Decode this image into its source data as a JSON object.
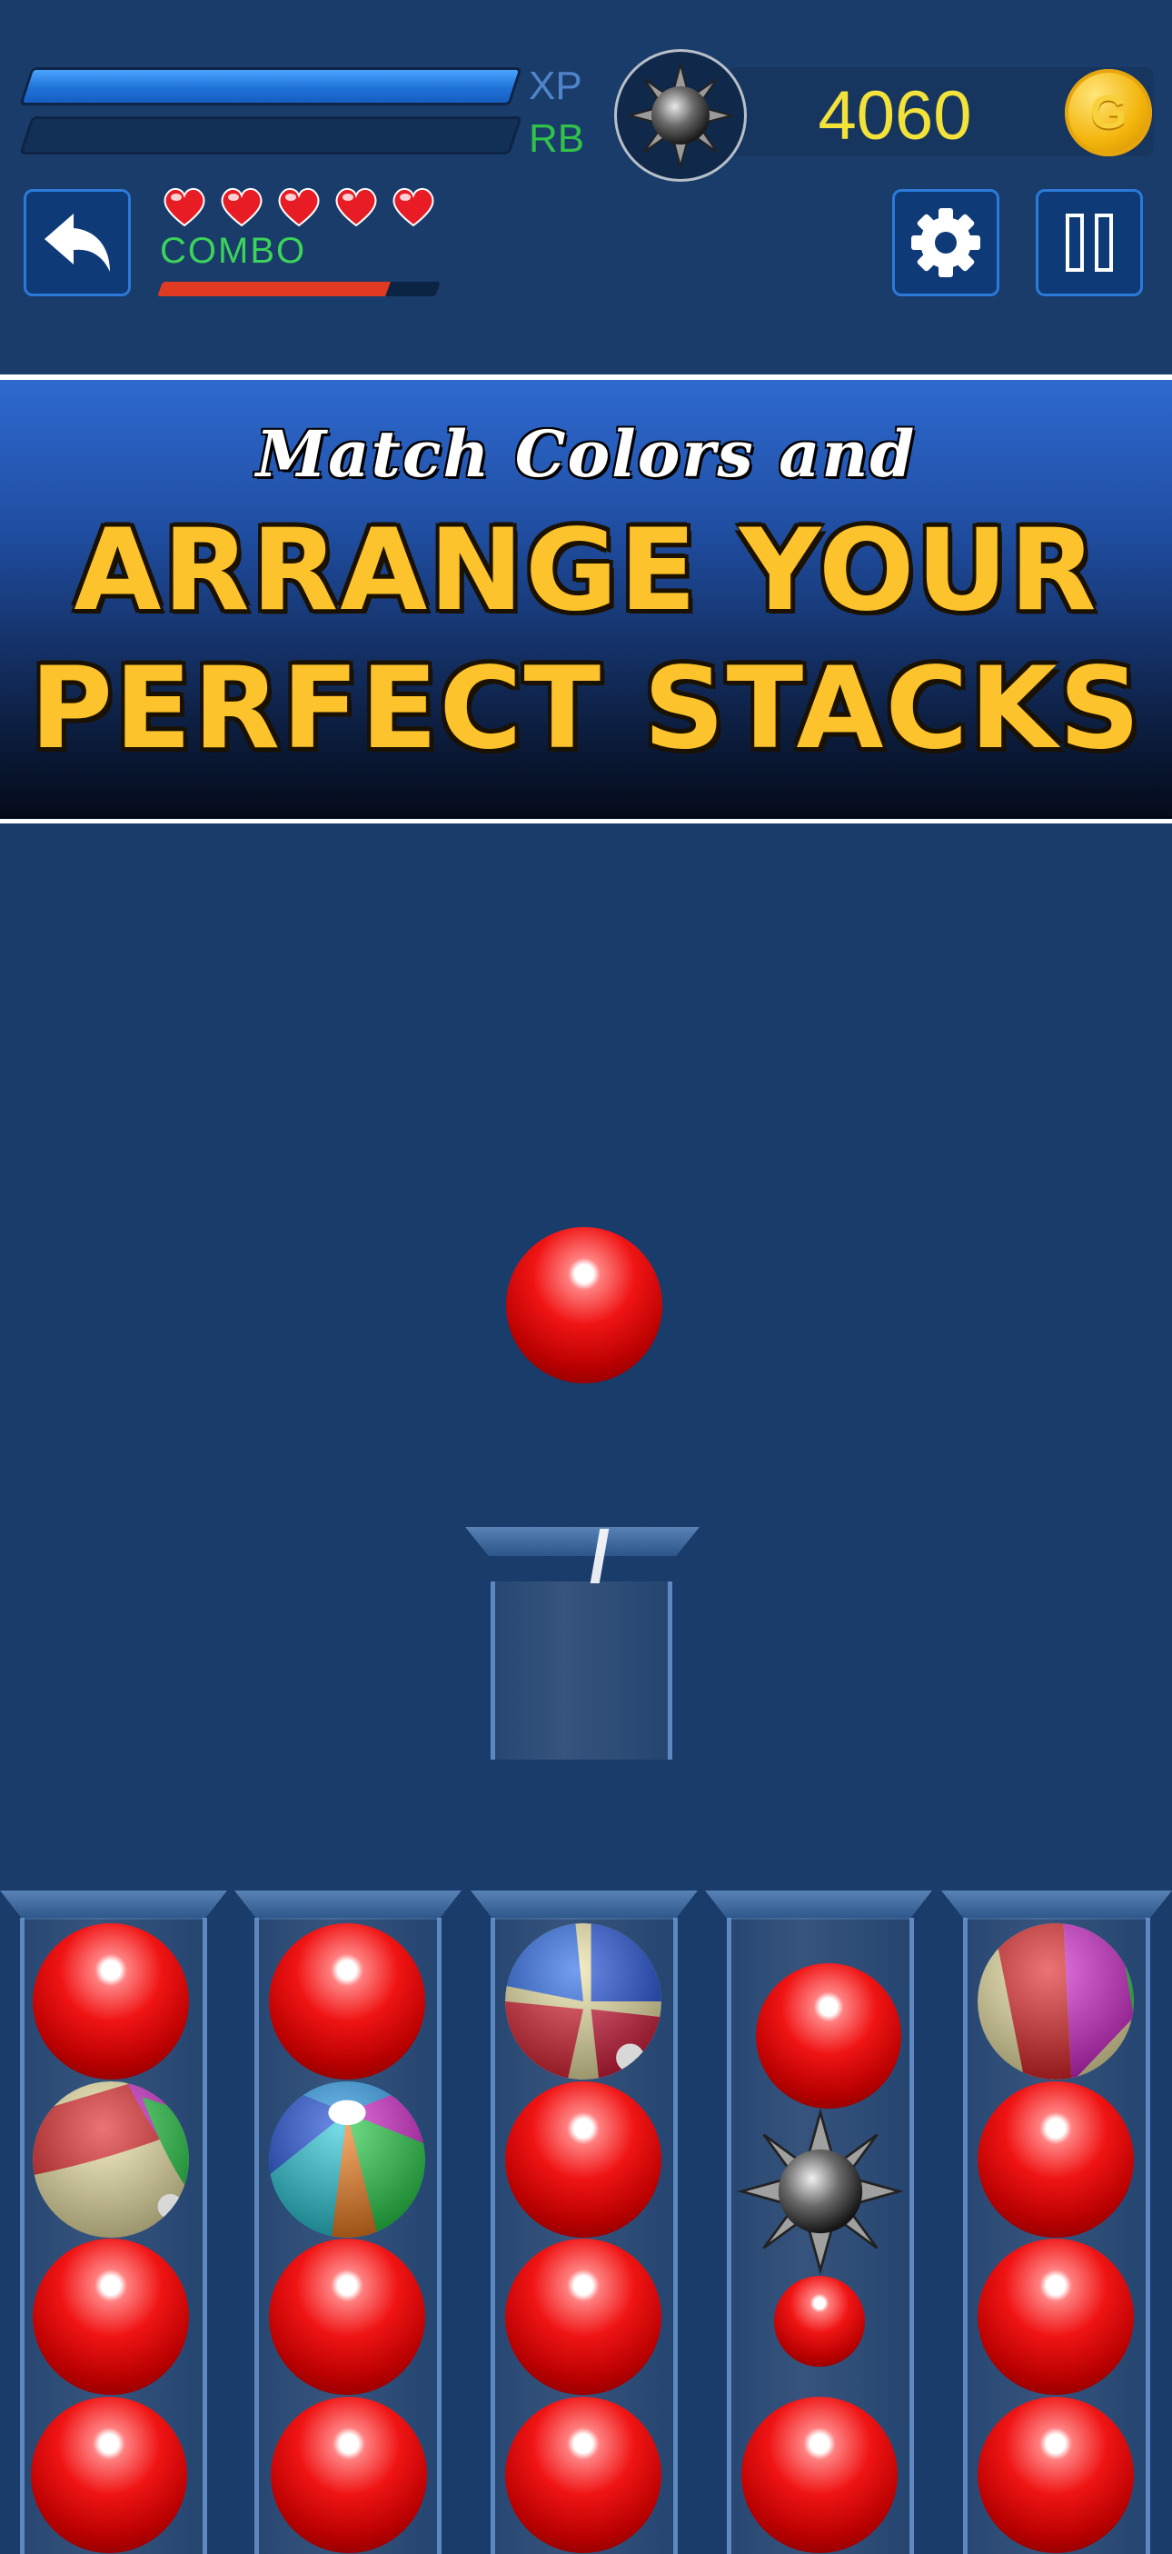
{
  "hud": {
    "xp_label": "XP",
    "rb_label": "RB",
    "xp_progress": 1.0,
    "rb_progress": 0.0,
    "coins": "4060",
    "coin_symbol": "G",
    "hearts": 5,
    "combo_label": "COMBO",
    "combo_progress": 0.82
  },
  "banner": {
    "subtitle": "Match Colors and",
    "line1": "ARRANGE YOUR",
    "line2": "PERFECT STACKS"
  },
  "colors": {
    "background": "#1a3c6a",
    "ball_red": "#f01414",
    "banner_text": "#fcc32c",
    "coin_text": "#f2e23a",
    "combo_text": "#3bd35a"
  },
  "board": {
    "held_ball": "red",
    "tubes": [
      {
        "balls": [
          "red",
          "beach-red-yellow-magenta",
          "red",
          "red"
        ]
      },
      {
        "balls": [
          "red",
          "beach-multicolor",
          "red",
          "red"
        ]
      },
      {
        "balls": [
          "beach-blue-red-yellow",
          "red",
          "red",
          "red"
        ]
      },
      {
        "balls": [
          "red",
          "spike-mine",
          "red-small",
          "red"
        ]
      },
      {
        "balls": [
          "beach-red-magenta",
          "red",
          "red",
          "red"
        ]
      }
    ]
  }
}
